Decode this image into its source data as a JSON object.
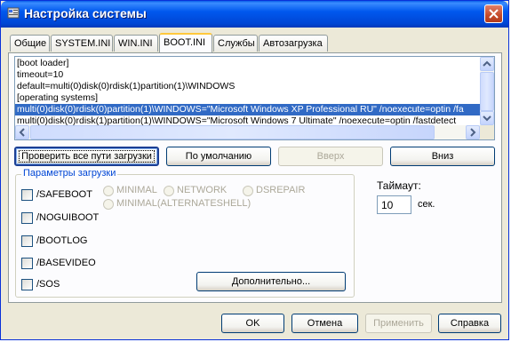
{
  "window": {
    "title": "Настройка системы"
  },
  "tabs": [
    {
      "label": "Общие"
    },
    {
      "label": "SYSTEM.INI"
    },
    {
      "label": "WIN.INI"
    },
    {
      "label": "BOOT.INI"
    },
    {
      "label": "Службы"
    },
    {
      "label": "Автозагрузка"
    }
  ],
  "boot_ini_lines": [
    "[boot loader]",
    "timeout=10",
    "default=multi(0)disk(0)rdisk(1)partition(1)\\WINDOWS",
    "[operating systems]",
    "multi(0)disk(0)rdisk(0)partition(1)\\WINDOWS=\"Microsoft Windows XP Professional RU\" /noexecute=optin /fa",
    "multi(0)disk(0)rdisk(1)partition(1)\\WINDOWS=\"Microsoft Windows 7 Ultimate\" /noexecute=optin /fastdetect"
  ],
  "buttons": {
    "check_all": "Проверить все пути загрузки",
    "default": "По умолчанию",
    "up": "Вверх",
    "down": "Вниз",
    "advanced": "Дополнительно...",
    "ok": "OK",
    "cancel": "Отмена",
    "apply": "Применить",
    "help": "Справка"
  },
  "boot_options": {
    "title": "Параметры загрузки",
    "checkboxes": [
      "/SAFEBOOT",
      "/NOGUIBOOT",
      "/BOOTLOG",
      "/BASEVIDEO",
      "/SOS"
    ],
    "radios": [
      "MINIMAL",
      "NETWORK",
      "DSREPAIR",
      "MINIMAL(ALTERNATESHELL)"
    ]
  },
  "timeout": {
    "label": "Таймаут:",
    "value": "10",
    "unit": "сек."
  },
  "colors": {
    "titlebar": "#0058ee",
    "selection": "#316ac5",
    "group_title": "#0046d5"
  }
}
